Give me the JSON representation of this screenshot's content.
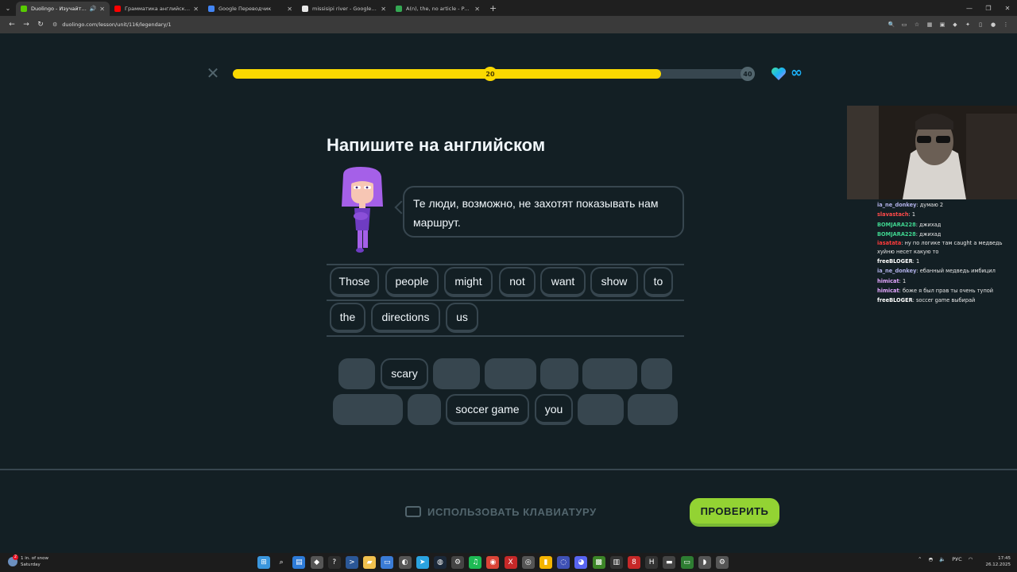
{
  "browser": {
    "tabs": [
      {
        "title": "Duolingo - Изучайте англи",
        "favicon_color": "#58cc02",
        "active": true,
        "audio": true
      },
      {
        "title": "Грамматика английского язы",
        "favicon_color": "#ff0000",
        "active": false,
        "audio": false
      },
      {
        "title": "Google Переводчик",
        "favicon_color": "#4285f4",
        "active": false,
        "audio": false
      },
      {
        "title": "missisipi river - Google Search",
        "favicon_color": "#e8e8e8",
        "active": false,
        "audio": false
      },
      {
        "title": "A(n), the, no article - Page 3 of",
        "favicon_color": "#34a853",
        "active": false,
        "audio": false
      }
    ],
    "url": "duolingo.com/lesson/unit/116/legendary/1"
  },
  "lesson": {
    "progress_fraction": 0.82,
    "marker_current": "20",
    "marker_goal": "40",
    "hearts": "∞",
    "title": "Напишите на английском",
    "prompt": "Те люди, возможно, не захотят показывать нам маршрут.",
    "answer_words_row1": [
      "Those",
      "people",
      "might",
      "not",
      "want",
      "show",
      "to"
    ],
    "answer_words_row2": [
      "the",
      "directions",
      "us"
    ],
    "bank_row1": [
      "",
      "scary",
      "",
      "",
      "",
      "",
      ""
    ],
    "bank_row2": [
      "",
      "",
      "soccer game",
      "you",
      "",
      ""
    ],
    "keyboard_label": "ИСПОЛЬЗОВАТЬ КЛАВИАТУРУ",
    "check_label": "ПРОВЕРИТЬ"
  },
  "chat": [
    {
      "user": "ia_ne_donkey",
      "color": "#b1b1e8",
      "text": "думаю 2"
    },
    {
      "user": "slavastach",
      "color": "#ff4a4a",
      "text": "1"
    },
    {
      "user": "BOMJARA228",
      "color": "#3fd48f",
      "text": "джихад"
    },
    {
      "user": "BOMJARA228",
      "color": "#3fd48f",
      "text": "джихад"
    },
    {
      "user": "iasatata",
      "color": "#ff3b3b",
      "text": "ну по логике там caught а медведь хуйню несет какую то"
    },
    {
      "user": "freeBLOGER",
      "color": "#ffffff",
      "text": "1"
    },
    {
      "user": "ia_ne_donkey",
      "color": "#b1b1e8",
      "text": "ебанный медведь имбицил"
    },
    {
      "user": "himicat",
      "color": "#e3a6ff",
      "text": "1"
    },
    {
      "user": "himicat",
      "color": "#e3a6ff",
      "text": "боже я был прав ты очень тупой"
    },
    {
      "user": "freeBLOGER",
      "color": "#ffffff",
      "text": "soccer game выбирай"
    }
  ],
  "taskbar": {
    "weather_line1": "1 in. of snow",
    "weather_line2": "Saturday",
    "lang": "РУС",
    "time": "17:45",
    "date": "26.12.2025",
    "notification_badge": "2"
  }
}
